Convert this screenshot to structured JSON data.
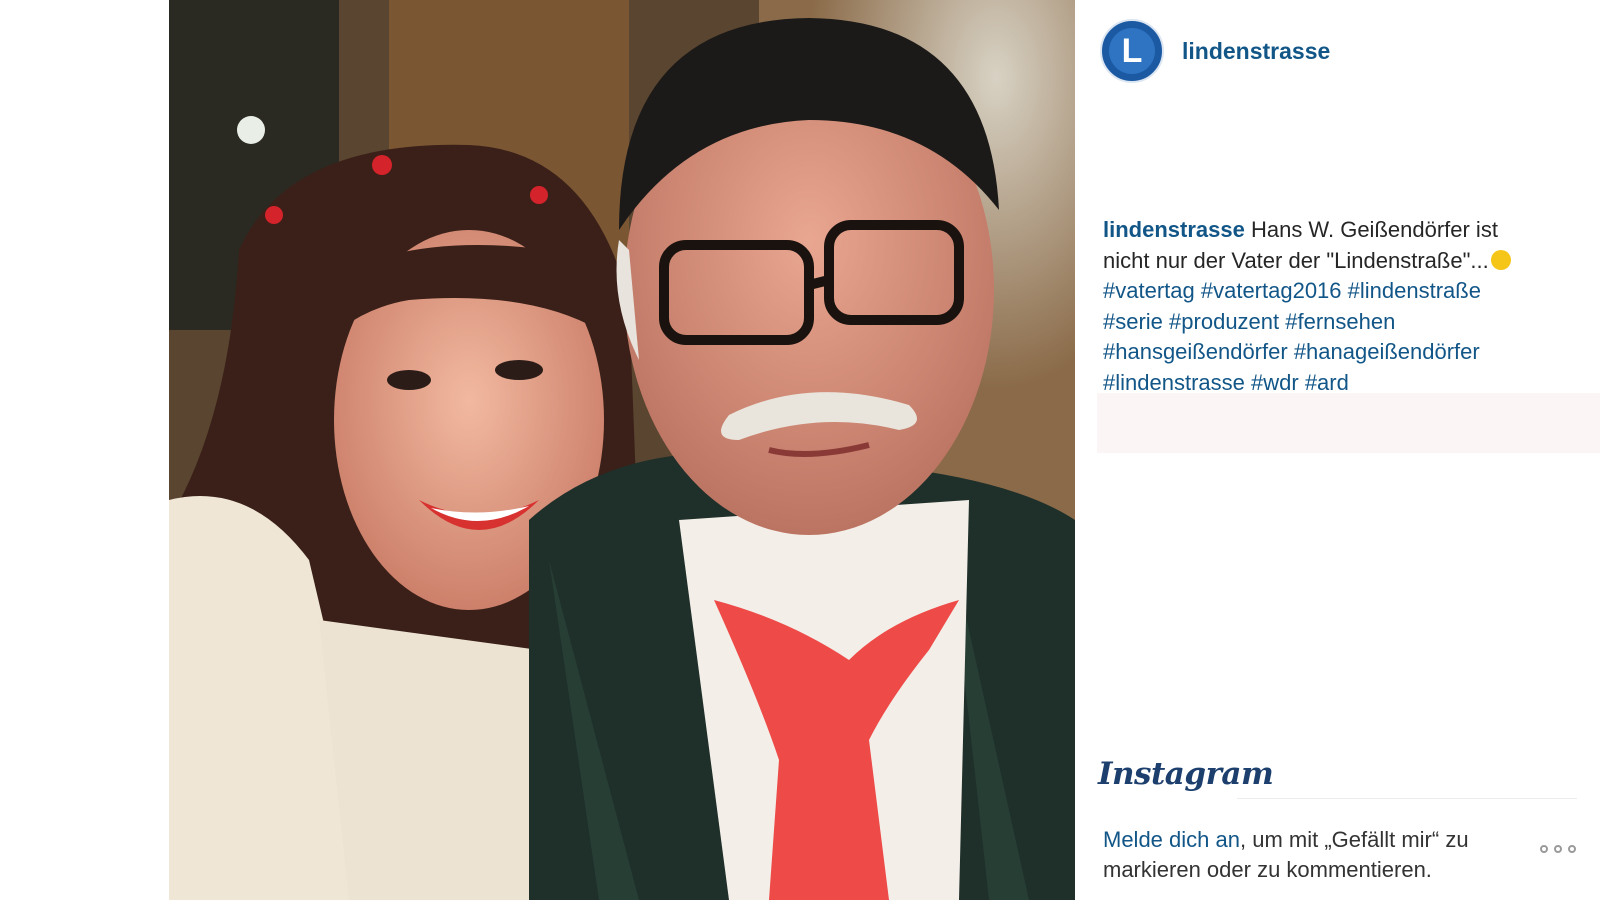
{
  "post": {
    "username": "lindenstrasse",
    "avatar_letter": "L",
    "caption": {
      "user": "lindenstrasse",
      "text": " Hans W. Geißendörfer ist nicht nur der Vater der \"Lindenstraße\"...",
      "emoji": "smiley-icon",
      "hashtags": [
        "#vatertag",
        "#vatertag2016",
        "#lindenstraße",
        "#serie",
        "#produzent",
        "#fernsehen",
        "#hansgeißendörfer",
        "#hanageißendörfer",
        "#lindenstrasse",
        "#wdr",
        "#ard"
      ]
    }
  },
  "footer": {
    "brand": "Instagram",
    "login_link": "Melde dich an",
    "login_text": ", um mit „Gefällt mir“ zu markieren oder zu kommentieren.",
    "more_icon": "more-icon"
  },
  "colors": {
    "link": "#125688",
    "avatar": "#1b5aa3"
  }
}
